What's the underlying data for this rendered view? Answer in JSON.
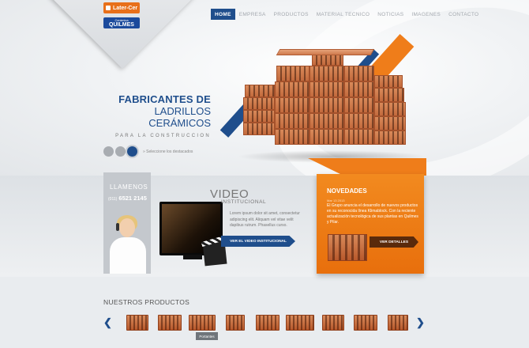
{
  "brand": {
    "logo_top": "Later-Cer",
    "logo_bottom_small": "Cerámica",
    "logo_bottom": "QUILMES"
  },
  "nav": {
    "items": [
      {
        "label": "HOME",
        "active": true
      },
      {
        "label": "EMPRESA",
        "active": false
      },
      {
        "label": "PRODUCTOS",
        "active": false
      },
      {
        "label": "MATERIAL TECNICO",
        "active": false
      },
      {
        "label": "NOTICIAS",
        "active": false
      },
      {
        "label": "IMAGENES",
        "active": false
      },
      {
        "label": "CONTACTO",
        "active": false
      }
    ]
  },
  "hero": {
    "title_line1": "FABRICANTES DE",
    "title_line2": "LADRILLOS CERÁMICOS",
    "title_line3": "PARA LA CONSTRUCCION",
    "slider_caption": "» Seleccione los destacados",
    "slide_count": 3,
    "active_slide": 3
  },
  "contact": {
    "label": "LLAMENOS",
    "phone_prefix": "(011)",
    "phone": "6521 2145"
  },
  "video": {
    "title": "VIDEO",
    "subtitle": "INSTITUCIONAL",
    "text": "Lorem ipsum dolor sit amet, consectetur adipiscing elit. Aliquam vel vitae velit dapibus rutrum. Phasellus curso.",
    "button": "VER EL VIDEO INSTITUCIONAL"
  },
  "news": {
    "title": "NOVEDADES",
    "date": "Mar 13 2013",
    "text": "El Grupo anuncia el desarrollo de nuevos productos en su reconocida línea Klimablock. Con la reciente actualización tecnológica de sus plantas en Quilmes y Pilar.",
    "button": "VER DETALLES"
  },
  "products": {
    "title": "NUESTROS PRODUCTOS",
    "prev": "❮",
    "next": "❯",
    "tooltip": "Portantes",
    "count": 9
  },
  "colors": {
    "blue": "#1f4e8c",
    "orange": "#ef7d1a",
    "brick": "#c36a3d",
    "background": "#e9ecef"
  }
}
